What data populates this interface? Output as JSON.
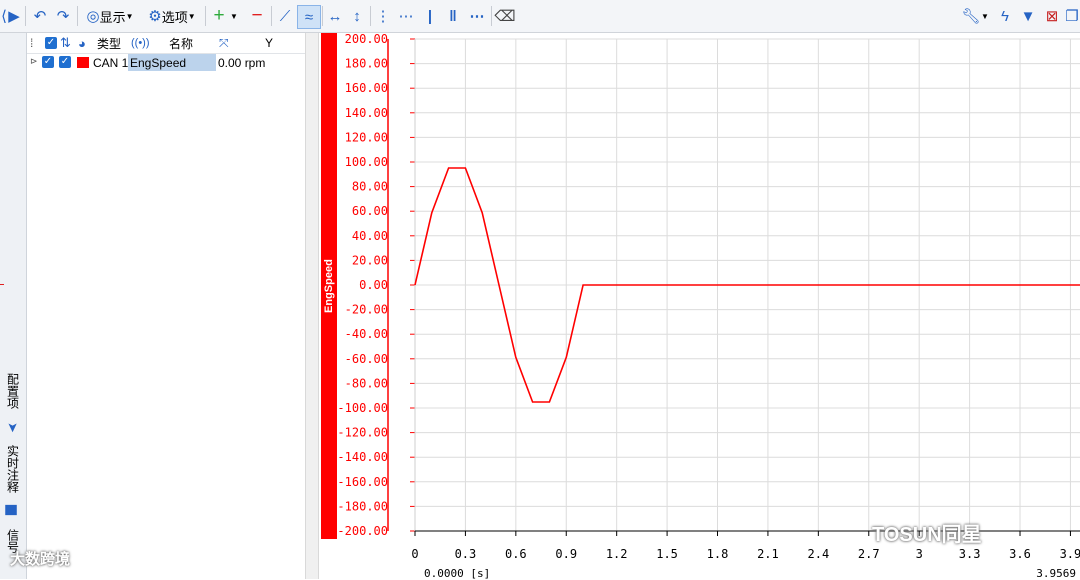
{
  "toolbar": {
    "display_label": "显示",
    "options_label": "选项"
  },
  "left_tabs": {
    "config": "配置项",
    "realtime_note": "实时注释",
    "signal": "信号"
  },
  "table": {
    "headers": {
      "type": "类型",
      "name": "名称",
      "y": "Y"
    },
    "row": {
      "type": "CAN 1",
      "name": "EngSpeed",
      "value": "0.00 rpm"
    },
    "row_color": "#ff0000"
  },
  "chart_data": {
    "type": "line",
    "ylabel": "EngSpeed",
    "x_start_label": "0.0000 [s]",
    "x_end_label": "3.9569",
    "xlim": [
      0,
      3.9569
    ],
    "ylim": [
      -200,
      200
    ],
    "x_ticks": [
      "0",
      "0.3",
      "0.6",
      "0.9",
      "1.2",
      "1.5",
      "1.8",
      "2.1",
      "2.4",
      "2.7",
      "3",
      "3.3",
      "3.6",
      "3.9"
    ],
    "y_ticks": [
      "200.00",
      "180.00",
      "160.00",
      "140.00",
      "120.00",
      "100.00",
      "80.00",
      "60.00",
      "40.00",
      "20.00",
      "0.00",
      "-20.00",
      "-40.00",
      "-60.00",
      "-80.00",
      "-100.00",
      "-120.00",
      "-140.00",
      "-160.00",
      "-180.00",
      "-200.00"
    ],
    "grid": true,
    "color": "#ff0000",
    "series": [
      {
        "x": [
          0,
          0.1,
          0.2,
          0.3,
          0.4,
          0.5,
          0.6,
          0.7,
          0.8,
          0.9,
          1.0,
          3.9569
        ],
        "values": [
          0,
          58.8,
          95.1,
          95.1,
          58.8,
          0,
          -58.8,
          -95.1,
          -95.1,
          -58.8,
          0,
          0
        ]
      }
    ]
  },
  "watermark": {
    "left": "大数跨境",
    "right": "TOSUN同星"
  }
}
